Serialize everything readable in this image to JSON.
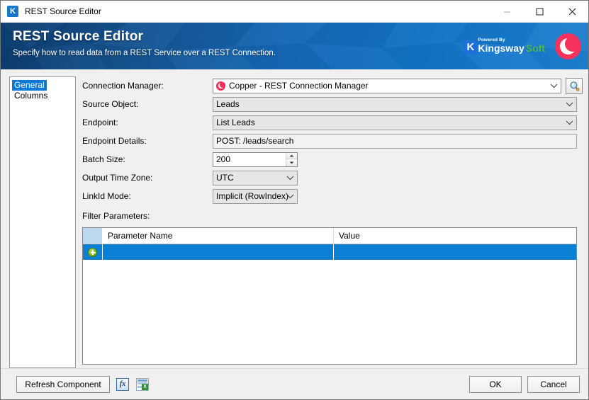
{
  "window": {
    "title": "REST Source Editor",
    "app_icon": "kingswaysoft-k-icon",
    "minimize_label": "Minimize",
    "maximize_label": "Maximize",
    "close_label": "Close"
  },
  "banner": {
    "title": "REST Source Editor",
    "subtitle": "Specify how to read data from a REST Service over a REST Connection.",
    "brand": {
      "powered_by": "Powered By",
      "name": "Kingsway",
      "name_accent": "Soft",
      "k_letter": "K",
      "logo_icon": "copper-logo-icon"
    },
    "colors": {
      "gradient_start": "#0d3c6e",
      "gradient_end": "#1d7fcf",
      "accent_green": "#4cb648",
      "copper_pink": "#f5315c"
    }
  },
  "nav": {
    "items": [
      {
        "label": "General",
        "selected": true
      },
      {
        "label": "Columns",
        "selected": false
      }
    ]
  },
  "form": {
    "connection_manager": {
      "label": "Connection Manager:",
      "value": "Copper - REST Connection Manager",
      "icon": "copper-logo-icon",
      "browse_icon": "magnifier-icon"
    },
    "source_object": {
      "label": "Source Object:",
      "value": "Leads"
    },
    "endpoint": {
      "label": "Endpoint:",
      "value": "List Leads"
    },
    "endpoint_details": {
      "label": "Endpoint Details:",
      "value": "POST: /leads/search"
    },
    "batch_size": {
      "label": "Batch Size:",
      "value": "200"
    },
    "output_time_zone": {
      "label": "Output Time Zone:",
      "value": "UTC"
    },
    "linkid_mode": {
      "label": "LinkId Mode:",
      "value": "Implicit (RowIndex)"
    },
    "filter_parameters": {
      "label": "Filter Parameters:"
    }
  },
  "grid": {
    "columns": [
      "Parameter Name",
      "Value"
    ],
    "rows": [
      {
        "new_row_icon": "add-row-icon",
        "parameter_name": "",
        "value": "",
        "selected": true
      }
    ],
    "selection_color": "#0b7fd4",
    "corner_color": "#bdd7ee"
  },
  "footer": {
    "refresh_label": "Refresh Component",
    "expression_icon": "fx-expression-icon",
    "expression_icon_label": "fx",
    "spreadsheet_icon": "spreadsheet-icon",
    "spreadsheet_icon_label": "X",
    "ok_label": "OK",
    "cancel_label": "Cancel"
  }
}
